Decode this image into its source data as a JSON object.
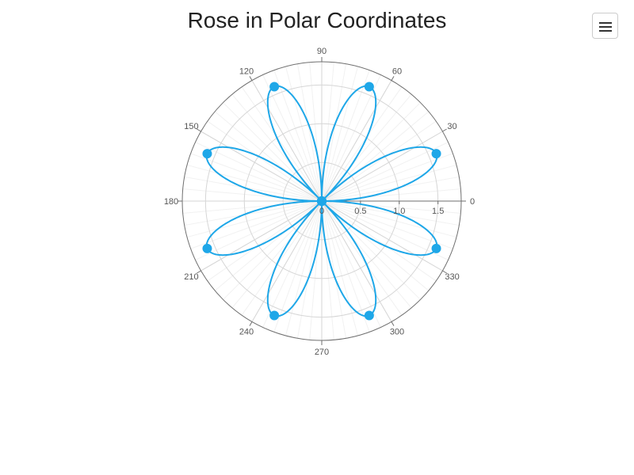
{
  "chart_data": {
    "type": "line",
    "subtype": "polar",
    "title": "Rose in Polar Coordinates",
    "series": [
      {
        "name": "",
        "equation": "r = 1.6 * |sin(4*theta)|",
        "color": "#1ea7e8",
        "points": [
          {
            "theta": 0,
            "r": 0
          },
          {
            "theta": 22.5,
            "r": 1.6
          },
          {
            "theta": 45,
            "r": 0
          },
          {
            "theta": 67.5,
            "r": 1.6
          },
          {
            "theta": 90,
            "r": 0
          },
          {
            "theta": 112.5,
            "r": 1.6
          },
          {
            "theta": 135,
            "r": 0
          },
          {
            "theta": 157.5,
            "r": 1.6
          },
          {
            "theta": 180,
            "r": 0
          },
          {
            "theta": 202.5,
            "r": 1.6
          },
          {
            "theta": 225,
            "r": 0
          },
          {
            "theta": 247.5,
            "r": 1.6
          },
          {
            "theta": 270,
            "r": 0
          },
          {
            "theta": 292.5,
            "r": 1.6
          },
          {
            "theta": 315,
            "r": 0
          },
          {
            "theta": 337.5,
            "r": 1.6
          },
          {
            "theta": 360,
            "r": 0
          }
        ]
      }
    ],
    "radial_axis": {
      "range": [
        0,
        1.8
      ],
      "ticks": [
        0,
        0.5,
        1.0,
        1.5
      ],
      "tick_labels": [
        "0",
        "0.5",
        "1.0",
        "1.5"
      ]
    },
    "angular_axis": {
      "unit": "degrees",
      "ticks": [
        0,
        30,
        60,
        90,
        120,
        150,
        180,
        210,
        240,
        270,
        300,
        330
      ],
      "tick_labels": [
        "0",
        "30",
        "60",
        "90",
        "120",
        "150",
        "180",
        "210",
        "240",
        "270",
        "300",
        "330"
      ],
      "minor_grid_step": 5
    },
    "grid": true,
    "legend": "none"
  },
  "toolbar": {
    "menu_icon": "hamburger-menu-icon"
  }
}
